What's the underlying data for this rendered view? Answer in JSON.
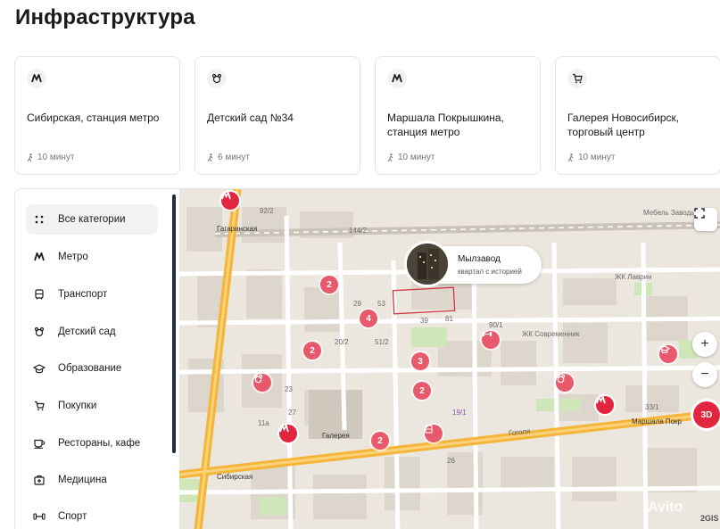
{
  "page": {
    "title": "Инфраструктура"
  },
  "cards": [
    {
      "icon": "metro-icon",
      "name": "Сибирская, станция метро",
      "time": "10 минут"
    },
    {
      "icon": "kindergarten-icon",
      "name": "Детский сад №34",
      "time": "6 минут"
    },
    {
      "icon": "metro-icon",
      "name": "Маршала Покрышкина, станция метро",
      "time": "10 минут"
    },
    {
      "icon": "shopping-cart-icon",
      "name": "Галерея Новосибирск, торговый центр",
      "time": "10 минут"
    }
  ],
  "sidebar": {
    "items": [
      {
        "label": "Все категории",
        "icon": "grid-dots-icon",
        "active": true
      },
      {
        "label": "Метро",
        "icon": "metro-icon"
      },
      {
        "label": "Транспорт",
        "icon": "bus-icon"
      },
      {
        "label": "Детский сад",
        "icon": "kindergarten-icon"
      },
      {
        "label": "Образование",
        "icon": "graduation-cap-icon"
      },
      {
        "label": "Покупки",
        "icon": "shopping-cart-icon"
      },
      {
        "label": "Рестораны, кафе",
        "icon": "coffee-cup-icon"
      },
      {
        "label": "Медицина",
        "icon": "medical-bag-icon"
      },
      {
        "label": "Спорт",
        "icon": "dumbbell-icon"
      }
    ]
  },
  "map": {
    "callout": {
      "name": "Мылзавод",
      "sub": "квартал с историей"
    },
    "cluster_counts": [
      "2",
      "4",
      "2",
      "3",
      "2",
      "2"
    ],
    "labels": {
      "gagarinskaya": "Гагаринская",
      "sibirskaya": "Сибирская",
      "pokryshkina": "Маршала Покр",
      "gogolya": "Гоголя",
      "galereya": "Галерея",
      "zhk_lavrin": "ЖК Лаврин",
      "zhk_sovremennik": "ЖК Современник",
      "mebel": "Мебель Заводь",
      "b1": "92/2",
      "b2": "144/2",
      "b3": "29",
      "b4": "53",
      "b5": "20/2",
      "b6": "51/2",
      "b7": "39",
      "b8": "81",
      "b9": "90/1",
      "b10": "19/1",
      "b11": "26",
      "b12": "33/1",
      "b13": "11а",
      "b14": "27",
      "b15": "23"
    },
    "zoom_in": "+",
    "zoom_out": "−",
    "btn_3d": "3D",
    "brand": "2GIS",
    "watermark": "Avito"
  },
  "colors": {
    "pin": "#e8596c",
    "metro": "#e3263f",
    "road_major": "#f5b53a",
    "road_minor": "#ffffff",
    "park": "#cfe6b8"
  }
}
